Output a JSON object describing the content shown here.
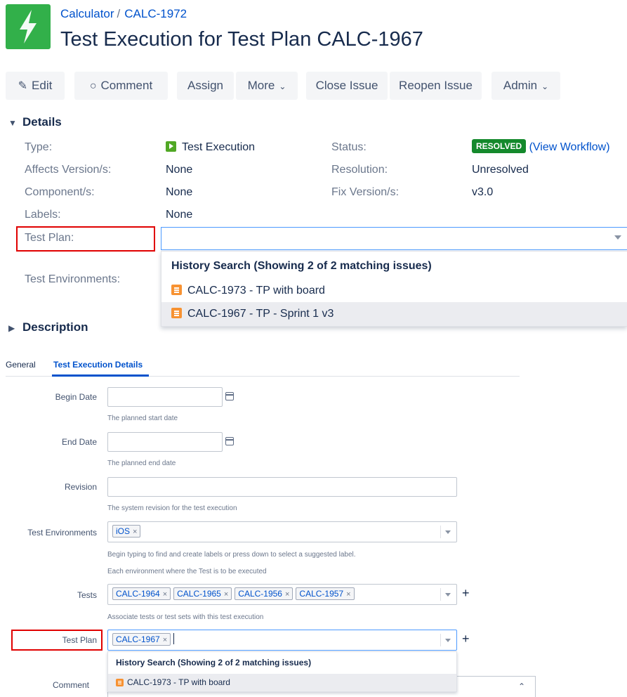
{
  "header": {
    "project": "Calculator",
    "separator": "/",
    "issue_key": "CALC-1972",
    "title": "Test Execution for Test Plan CALC-1967"
  },
  "toolbar": {
    "edit": "Edit",
    "comment": "Comment",
    "assign": "Assign",
    "more": "More",
    "close_issue": "Close Issue",
    "reopen_issue": "Reopen Issue",
    "admin": "Admin"
  },
  "details": {
    "heading": "Details",
    "type_label": "Type:",
    "type_value": "Test Execution",
    "status_label": "Status:",
    "status_value": "RESOLVED",
    "view_workflow": "(View Workflow)",
    "affects_label": "Affects Version/s:",
    "affects_value": "None",
    "resolution_label": "Resolution:",
    "resolution_value": "Unresolved",
    "component_label": "Component/s:",
    "component_value": "None",
    "fix_label": "Fix Version/s:",
    "fix_value": "v3.0",
    "labels_label": "Labels:",
    "labels_value": "None",
    "test_plan_label": "Test Plan:",
    "test_env_label": "Test Environments:",
    "dropdown": {
      "heading": "History Search (Showing 2 of 2 matching issues)",
      "items": [
        "CALC-1973 - TP with board",
        "CALC-1967 - TP - Sprint 1 v3"
      ]
    }
  },
  "description": {
    "heading": "Description"
  },
  "tabs": {
    "general": "General",
    "test_execution_details": "Test Execution Details"
  },
  "form": {
    "begin_date_label": "Begin Date",
    "begin_date_hint": "The planned start date",
    "end_date_label": "End Date",
    "end_date_hint": "The planned end date",
    "revision_label": "Revision",
    "revision_hint": "The system revision for the test execution",
    "test_env_label": "Test Environments",
    "test_env_values": [
      "iOS"
    ],
    "test_env_hint1": "Begin typing to find and create labels or press down to select a suggested label.",
    "test_env_hint2": "Each environment where the Test is to be executed",
    "tests_label": "Tests",
    "tests_values": [
      "CALC-1964",
      "CALC-1965",
      "CALC-1956",
      "CALC-1957"
    ],
    "tests_hint": "Associate tests or test sets with this test execution",
    "test_plan_label": "Test Plan",
    "test_plan_values": [
      "CALC-1967"
    ],
    "remove_glyph": "×",
    "plus_glyph": "+",
    "dropdown": {
      "heading": "History Search (Showing 2 of 2 matching issues)",
      "items": [
        "CALC-1973 - TP with board"
      ]
    },
    "comment_label": "Comment"
  },
  "colors": {
    "accent": "#0052cc",
    "status_green": "#14892c",
    "highlight_red": "#e00000",
    "logo_green": "#32b04a"
  }
}
